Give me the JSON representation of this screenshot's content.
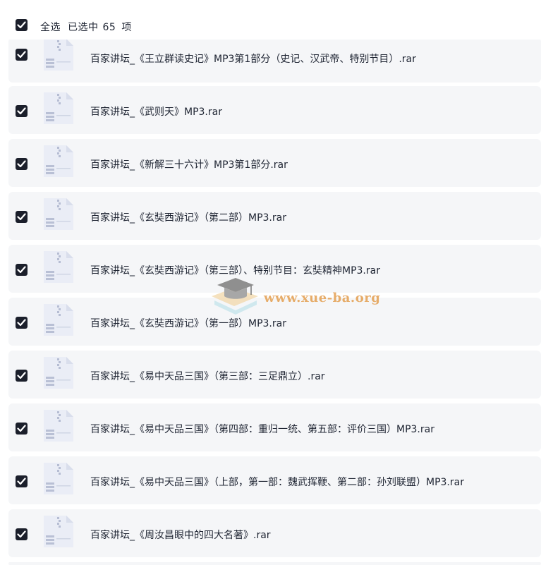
{
  "header": {
    "select_all_label": "全选",
    "selected_text": "已选中",
    "selected_count": "65",
    "items_unit": "项"
  },
  "files": [
    {
      "name": "百家讲坛_《王立群读史记》MP3第1部分（史记、汉武帝、特别节目）.rar"
    },
    {
      "name": "百家讲坛_《武则天》MP3.rar"
    },
    {
      "name": "百家讲坛_《新解三十六计》MP3第1部分.rar"
    },
    {
      "name": "百家讲坛_《玄奘西游记》（第二部）MP3.rar"
    },
    {
      "name": "百家讲坛_《玄奘西游记》（第三部）、特别节目：玄奘精神MP3.rar"
    },
    {
      "name": "百家讲坛_《玄奘西游记》（第一部）MP3.rar"
    },
    {
      "name": "百家讲坛_《易中天品三国》（第三部：三足鼎立）.rar"
    },
    {
      "name": "百家讲坛_《易中天品三国》（第四部：重归一统、第五部：评价三国）MP3.rar"
    },
    {
      "name": "百家讲坛_《易中天品三国》（上部，第一部：魏武挥鞭、第二部：孙刘联盟）MP3.rar"
    },
    {
      "name": "百家讲坛_《周汝昌眼中的四大名著》.rar"
    }
  ],
  "icons": {
    "checkbox": "checkbox-checked-icon",
    "file": "zip-file-icon"
  },
  "colors": {
    "checkbox": "#1b1f2b",
    "row_bg": "#f5f6f8",
    "watermark": "#e5a45a"
  },
  "watermark": {
    "text": "www.xue-ba.org"
  }
}
